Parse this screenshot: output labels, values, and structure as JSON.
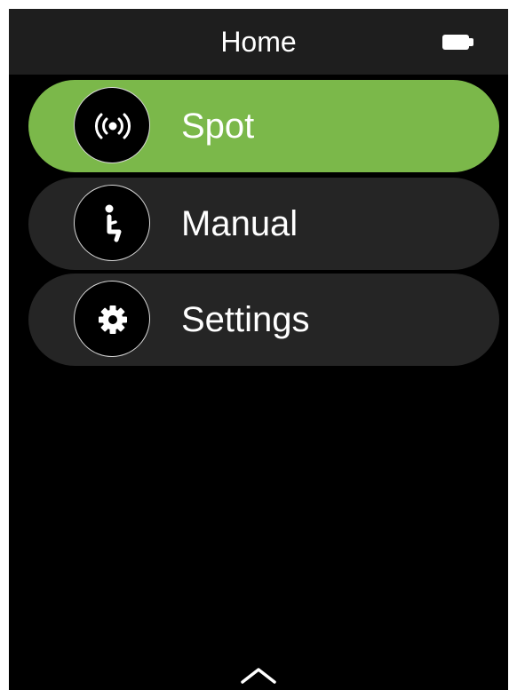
{
  "header": {
    "title": "Home",
    "battery_icon": "battery-full-icon"
  },
  "menu": {
    "items": [
      {
        "label": "Spot",
        "icon": "wireless-signal-icon",
        "active": true
      },
      {
        "label": "Manual",
        "icon": "person-sitting-icon",
        "active": false
      },
      {
        "label": "Settings",
        "icon": "gear-icon",
        "active": false
      }
    ]
  },
  "footer": {
    "icon": "chevron-up-icon"
  },
  "colors": {
    "active_item": "#7bb84a",
    "inactive_item": "#252525",
    "header_bg": "#1e1e1e",
    "screen_bg": "#000000",
    "text": "#ffffff"
  }
}
